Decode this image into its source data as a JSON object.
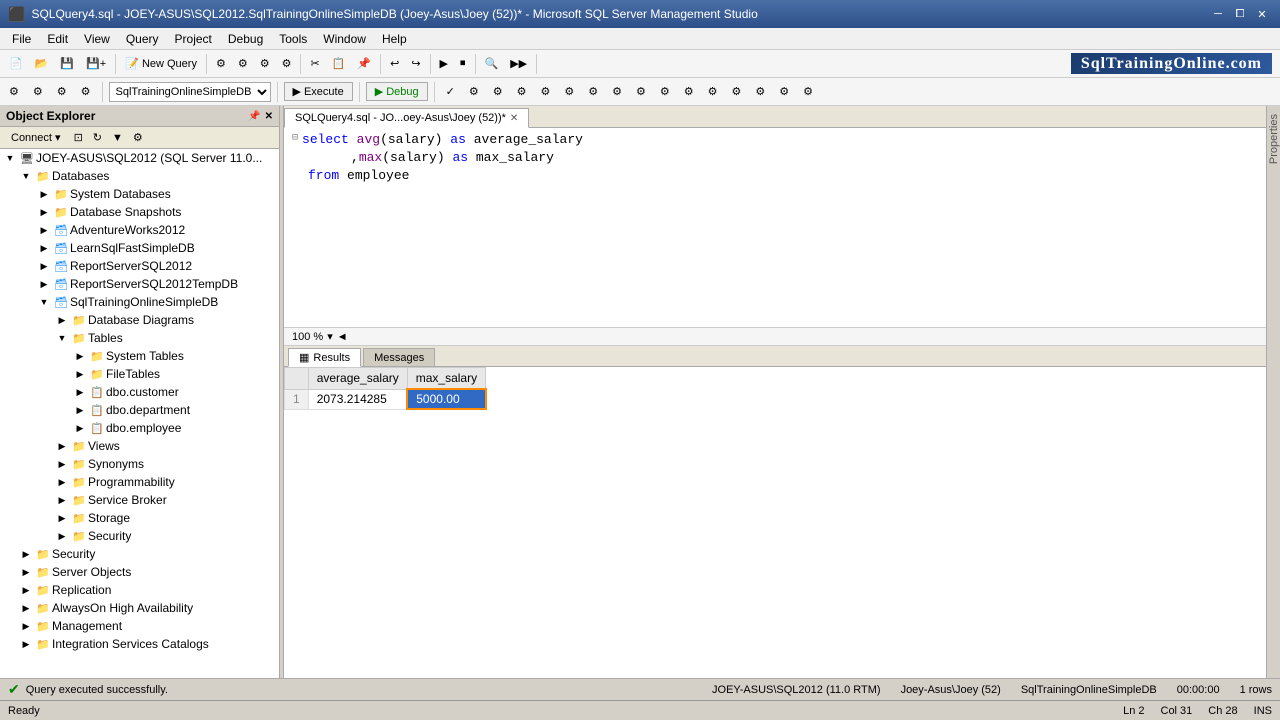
{
  "window": {
    "title": "SQLQuery4.sql - JOEY-ASUS\\SQL2012.SqlTrainingOnlineSimpleDB (Joey-Asus\\Joey (52))* - Microsoft SQL Server Management Studio"
  },
  "menu": {
    "items": [
      "File",
      "Edit",
      "View",
      "Query",
      "Project",
      "Debug",
      "Tools",
      "Window",
      "Help"
    ]
  },
  "toolbar2": {
    "database": "SqlTrainingOnlineSimpleDB",
    "execute_label": "Execute",
    "debug_label": "Debug"
  },
  "tabs": [
    {
      "label": "SQLQuery4.sql - JO...oey-Asus\\Joey (52))*",
      "active": true
    }
  ],
  "editor": {
    "zoom": "100 %",
    "lines": [
      {
        "num": "",
        "expand": true,
        "content": "select avg(salary) as average_salary",
        "indent": 0
      },
      {
        "num": "",
        "expand": false,
        "content": ",max(salary) as max_salary",
        "indent": 1
      },
      {
        "num": "",
        "expand": false,
        "content": "from employee",
        "indent": 0
      }
    ]
  },
  "results_tabs": [
    {
      "label": "Results",
      "active": true,
      "icon": "grid"
    },
    {
      "label": "Messages",
      "active": false,
      "icon": "message"
    }
  ],
  "results": {
    "columns": [
      "",
      "average_salary",
      "max_salary"
    ],
    "rows": [
      [
        "1",
        "2073.214285",
        "5000.00"
      ]
    ],
    "selected_cell": [
      0,
      2
    ]
  },
  "object_explorer": {
    "header": "Object Explorer",
    "connect_label": "Connect",
    "tree": [
      {
        "level": 0,
        "expanded": true,
        "label": "JOEY-ASUS\\SQL2012 (SQL Server 11.0...",
        "type": "server"
      },
      {
        "level": 1,
        "expanded": true,
        "label": "Databases",
        "type": "folder"
      },
      {
        "level": 2,
        "expanded": false,
        "label": "System Databases",
        "type": "folder"
      },
      {
        "level": 2,
        "expanded": false,
        "label": "Database Snapshots",
        "type": "folder"
      },
      {
        "level": 2,
        "expanded": false,
        "label": "AdventureWorks2012",
        "type": "db"
      },
      {
        "level": 2,
        "expanded": false,
        "label": "LearnSqlFastSimpleDB",
        "type": "db"
      },
      {
        "level": 2,
        "expanded": false,
        "label": "ReportServerSQL2012",
        "type": "db"
      },
      {
        "level": 2,
        "expanded": false,
        "label": "ReportServerSQL2012TempDB",
        "type": "db"
      },
      {
        "level": 2,
        "expanded": true,
        "label": "SqlTrainingOnlineSimpleDB",
        "type": "db"
      },
      {
        "level": 3,
        "expanded": false,
        "label": "Database Diagrams",
        "type": "folder"
      },
      {
        "level": 3,
        "expanded": true,
        "label": "Tables",
        "type": "folder"
      },
      {
        "level": 4,
        "expanded": false,
        "label": "System Tables",
        "type": "folder"
      },
      {
        "level": 4,
        "expanded": false,
        "label": "FileTables",
        "type": "folder"
      },
      {
        "level": 4,
        "expanded": false,
        "label": "dbo.customer",
        "type": "folder"
      },
      {
        "level": 4,
        "expanded": false,
        "label": "dbo.department",
        "type": "folder"
      },
      {
        "level": 4,
        "expanded": false,
        "label": "dbo.employee",
        "type": "folder"
      },
      {
        "level": 3,
        "expanded": false,
        "label": "Views",
        "type": "folder"
      },
      {
        "level": 3,
        "expanded": false,
        "label": "Synonyms",
        "type": "folder"
      },
      {
        "level": 3,
        "expanded": false,
        "label": "Programmability",
        "type": "folder"
      },
      {
        "level": 3,
        "expanded": false,
        "label": "Service Broker",
        "type": "folder"
      },
      {
        "level": 3,
        "expanded": false,
        "label": "Storage",
        "type": "folder"
      },
      {
        "level": 3,
        "expanded": false,
        "label": "Security",
        "type": "folder"
      },
      {
        "level": 1,
        "expanded": false,
        "label": "Security",
        "type": "folder"
      },
      {
        "level": 1,
        "expanded": false,
        "label": "Server Objects",
        "type": "folder"
      },
      {
        "level": 1,
        "expanded": false,
        "label": "Replication",
        "type": "folder"
      },
      {
        "level": 1,
        "expanded": false,
        "label": "AlwaysOn High Availability",
        "type": "folder"
      },
      {
        "level": 1,
        "expanded": false,
        "label": "Management",
        "type": "folder"
      },
      {
        "level": 1,
        "expanded": false,
        "label": "Integration Services Catalogs",
        "type": "folder"
      }
    ]
  },
  "status_bar": {
    "message": "Query executed successfully.",
    "server": "JOEY-ASUS\\SQL2012 (11.0 RTM)",
    "login": "Joey-Asus\\Joey (52)",
    "database": "SqlTrainingOnlineSimpleDB",
    "time": "00:00:00",
    "rows": "1 rows"
  },
  "bottom_bar": {
    "status": "Ready",
    "ln": "Ln 2",
    "col": "Col 31",
    "ch": "Ch 28",
    "ins": "INS"
  },
  "properties_panel": {
    "label": "Properties"
  },
  "logo": {
    "text": "SqlTrainingOnline.com"
  }
}
